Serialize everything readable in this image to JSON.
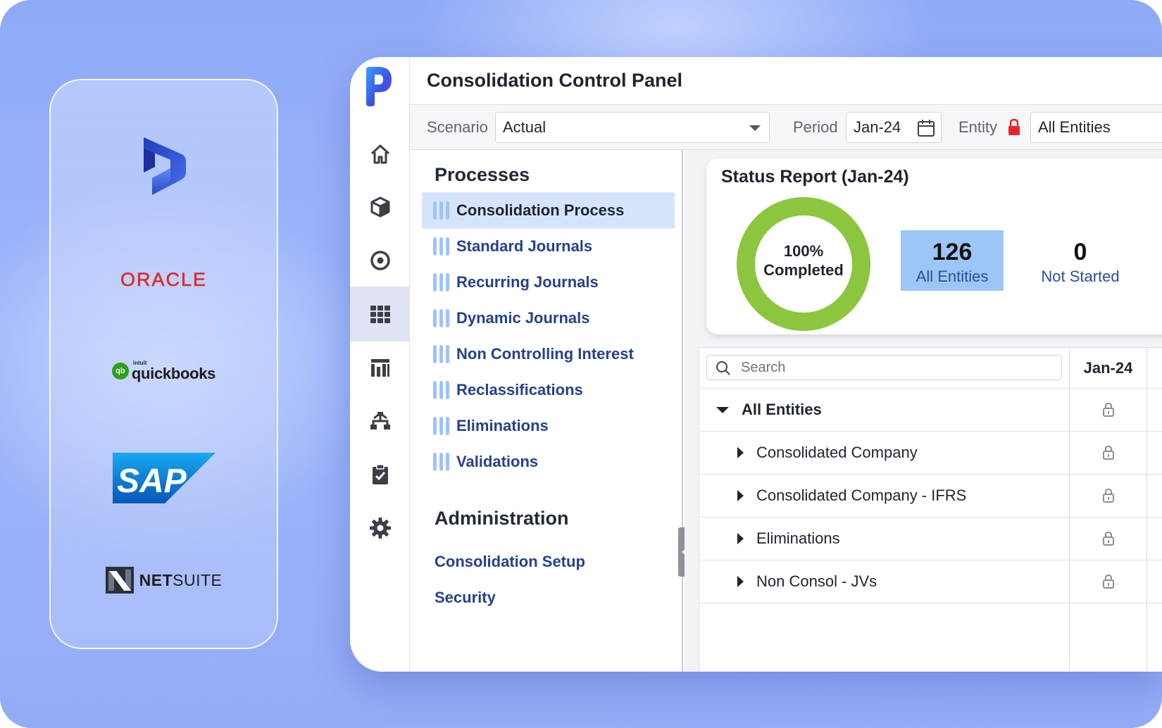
{
  "integrations": {
    "oracle": "ORACLE",
    "quickbooks_intuit": "intuit",
    "quickbooks": "quickbooks",
    "quickbooks_badge": "qb",
    "sap": "SAP",
    "netsuite_prefix": "NET",
    "netsuite_suffix": "SUITE"
  },
  "app": {
    "title": "Consolidation Control Panel",
    "nav_icons": [
      "home-icon",
      "cube-icon",
      "target-icon",
      "grid-icon",
      "report-icon",
      "hierarchy-icon",
      "clipboard-check-icon",
      "gear-icon"
    ],
    "active_nav": "grid-icon"
  },
  "filters": {
    "scenario_label": "Scenario",
    "scenario_value": "Actual",
    "period_label": "Period",
    "period_value": "Jan-24",
    "entity_label": "Entity",
    "entity_value": "All Entities"
  },
  "processes": {
    "title": "Processes",
    "items": [
      {
        "label": "Consolidation Process",
        "active": true
      },
      {
        "label": "Standard Journals"
      },
      {
        "label": "Recurring Journals"
      },
      {
        "label": "Dynamic Journals"
      },
      {
        "label": "Non Controlling Interest"
      },
      {
        "label": "Reclassifications"
      },
      {
        "label": "Eliminations"
      },
      {
        "label": "Validations"
      }
    ]
  },
  "administration": {
    "title": "Administration",
    "items": [
      "Consolidation Setup",
      "Security"
    ]
  },
  "status_report": {
    "title": "Status Report (Jan-24)",
    "completion_pct": "100%",
    "completion_label": "Completed",
    "completion_fraction": 1.0,
    "tiles": [
      {
        "value": "126",
        "label": "All Entities",
        "highlight": true
      },
      {
        "value": "0",
        "label": "Not Started",
        "highlight": false
      }
    ],
    "colors": {
      "donut": "#8cc63f",
      "tile": "#9cc6f5"
    }
  },
  "entity_grid": {
    "search_placeholder": "Search",
    "column_header": "Jan-24",
    "rows": [
      {
        "label": "All Entities",
        "expanded": true,
        "level": 0
      },
      {
        "label": "Consolidated Company",
        "expanded": false,
        "level": 1
      },
      {
        "label": "Consolidated Company - IFRS",
        "expanded": false,
        "level": 1
      },
      {
        "label": "Eliminations",
        "expanded": false,
        "level": 1
      },
      {
        "label": "Non Consol - JVs",
        "expanded": false,
        "level": 1
      }
    ]
  }
}
